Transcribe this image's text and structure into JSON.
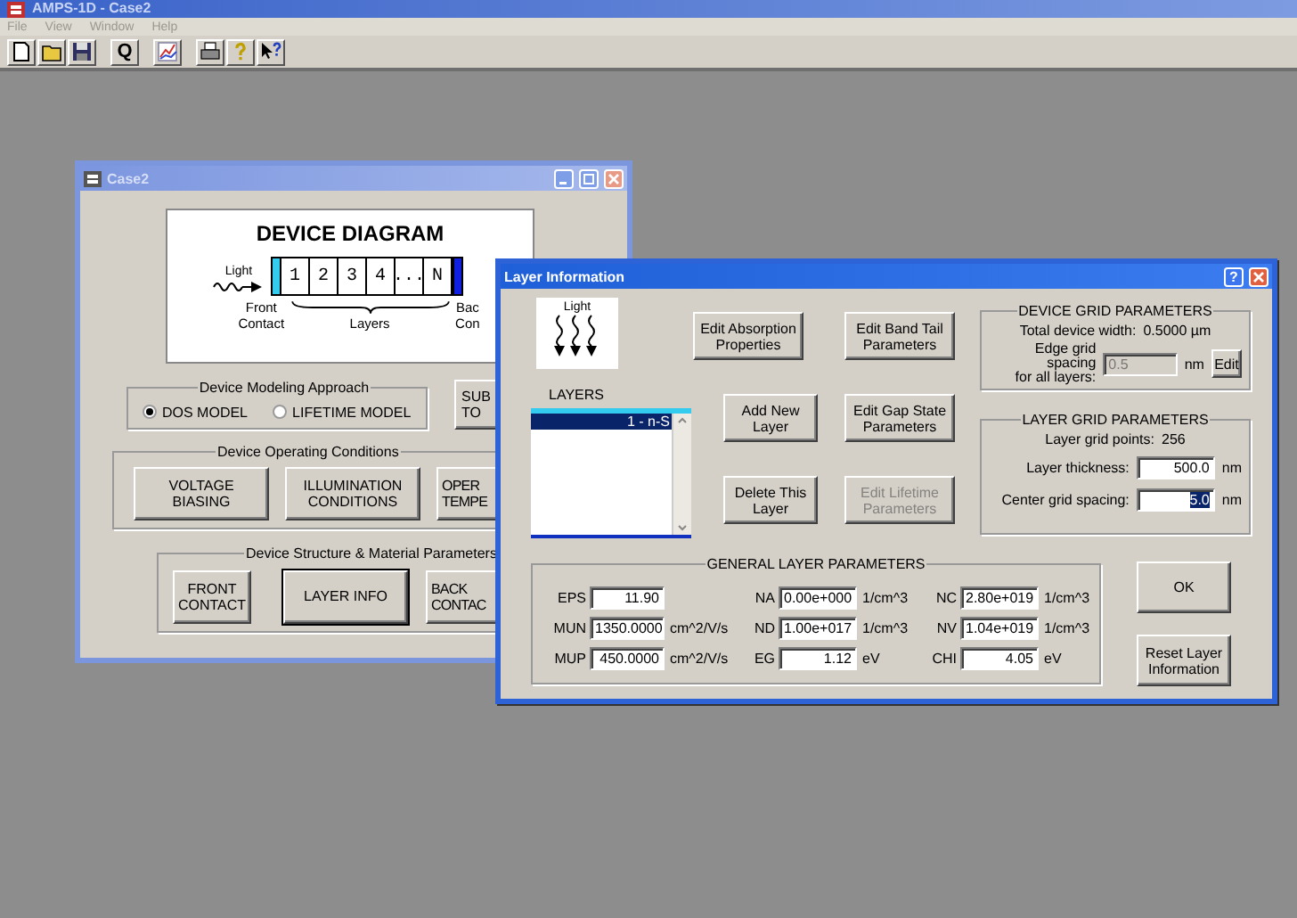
{
  "app": {
    "title": "AMPS-1D - Case2",
    "menu": [
      "File",
      "View",
      "Window",
      "Help"
    ],
    "toolbar": [
      {
        "kind": "icon"
      },
      {
        "kind": "icon"
      },
      {
        "kind": "icon"
      },
      {
        "kind": "text",
        "text": "Q"
      },
      {
        "kind": "icon"
      },
      {
        "kind": "icon"
      },
      {
        "kind": "icon"
      },
      {
        "kind": "icon"
      }
    ]
  },
  "case_window": {
    "title": "Case2",
    "diagram": {
      "title": "DEVICE DIAGRAM",
      "light": "Light",
      "cells": [
        "1",
        "2",
        "3",
        "4",
        "...",
        "N"
      ],
      "front_label": "Front\nContact",
      "layers_label": "Layers",
      "back_label": "Bac\nCon"
    },
    "modeling": {
      "legend": "Device Modeling Approach",
      "options": [
        {
          "label": "DOS MODEL",
          "selected": true
        },
        {
          "label": "LIFETIME MODEL",
          "selected": false
        }
      ]
    },
    "side_button": "SUB\nTO",
    "operating": {
      "legend": "Device Operating Conditions",
      "buttons": [
        "VOLTAGE\nBIASING",
        "ILLUMINATION\nCONDITIONS",
        "OPER\nTEMPE"
      ]
    },
    "structure": {
      "legend": "Device Structure & Material Parameters",
      "buttons": [
        {
          "label": "FRONT\nCONTACT",
          "default": false
        },
        {
          "label": "LAYER INFO",
          "default": true
        },
        {
          "label": "BACK\nCONTAC",
          "default": false
        }
      ]
    }
  },
  "layer_window": {
    "title": "Layer Information",
    "help_button": "?",
    "light": "Light",
    "layers_label": "LAYERS",
    "layers": [
      {
        "label": "1 - n-S",
        "selected": true
      }
    ],
    "buttons": [
      {
        "label": "Edit Absorption\nProperties",
        "disabled": false
      },
      {
        "label": "Edit Band Tail\nParameters",
        "disabled": false
      },
      {
        "label": "Add New\nLayer",
        "disabled": false
      },
      {
        "label": "Edit Gap State\nParameters",
        "disabled": false
      },
      {
        "label": "Delete This\nLayer",
        "disabled": false
      },
      {
        "label": "Edit Lifetime\nParameters",
        "disabled": true
      }
    ],
    "device_grid": {
      "legend": "DEVICE GRID PARAMETERS",
      "width_label": "Total device width:",
      "width_value": "0.5000 µm",
      "edge_label": "Edge grid spacing\nfor all layers:",
      "edge_value": "0.5",
      "edge_disabled": true,
      "edge_unit": "nm",
      "edit_button": "Edit"
    },
    "layer_grid": {
      "legend": "LAYER GRID PARAMETERS",
      "points_label": "Layer grid points:",
      "points_value": "256",
      "thickness_label": "Layer thickness:",
      "thickness_value": "500.0",
      "thickness_unit": "nm",
      "spacing_label": "Center grid spacing:",
      "spacing_value": "5.0",
      "spacing_selected": true,
      "spacing_unit": "nm"
    },
    "general": {
      "legend": "GENERAL LAYER PARAMETERS",
      "params": [
        {
          "name": "EPS",
          "value": "11.90"
        },
        {
          "name": "NA",
          "value": "0.00e+000",
          "unit": "1/cm^3"
        },
        {
          "name": "NC",
          "value": "2.80e+019",
          "unit": "1/cm^3"
        },
        {
          "name": "MUN",
          "value": "1350.0000",
          "unit": "cm^2/V/s"
        },
        {
          "name": "ND",
          "value": "1.00e+017",
          "unit": "1/cm^3"
        },
        {
          "name": "NV",
          "value": "1.04e+019",
          "unit": "1/cm^3"
        },
        {
          "name": "MUP",
          "value": "450.0000",
          "unit": "cm^2/V/s"
        },
        {
          "name": "EG",
          "value": "1.12",
          "unit": "eV"
        },
        {
          "name": "CHI",
          "value": "4.05",
          "unit": "eV"
        }
      ]
    },
    "ok_button": "OK",
    "reset_button": "Reset Layer\nInformation"
  }
}
